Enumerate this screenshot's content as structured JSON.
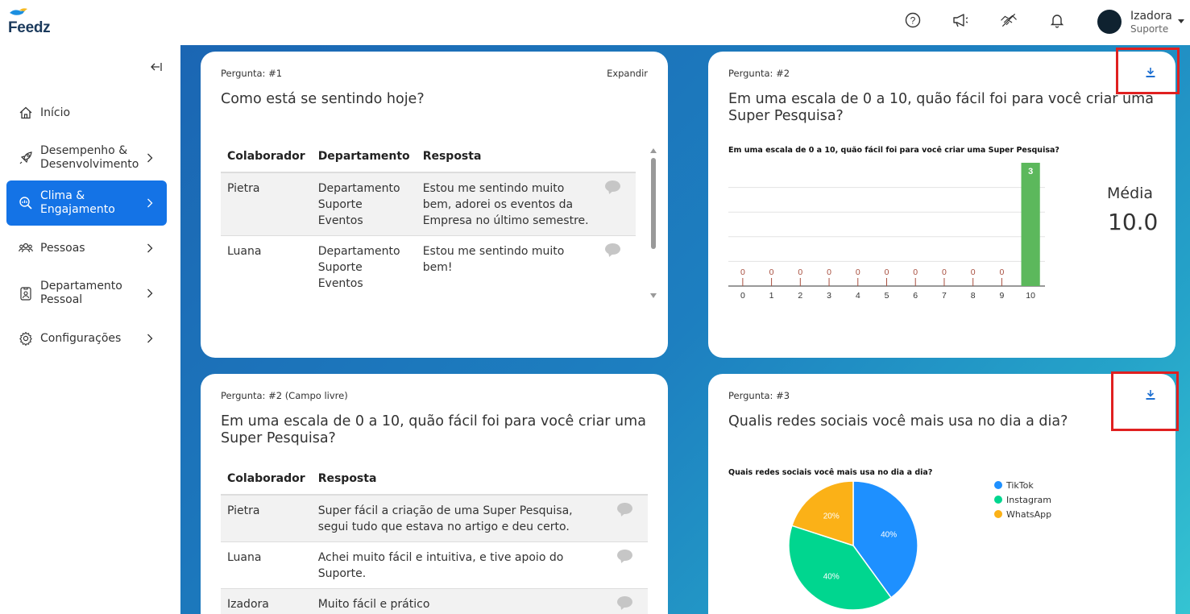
{
  "app": {
    "name": "Feedz"
  },
  "topbar": {
    "icons": [
      "help-icon",
      "megaphone-icon",
      "handshake-icon",
      "bell-icon"
    ],
    "user": {
      "name": "Izadora",
      "role": "Suporte"
    }
  },
  "sidebar": {
    "items": [
      {
        "label": "Início",
        "icon": "home-icon",
        "active": false,
        "chevron": false
      },
      {
        "label": "Desempenho &\nDesenvolvimento",
        "icon": "rocket-icon",
        "active": false,
        "chevron": true
      },
      {
        "label": "Clima &\nEngajamento",
        "icon": "magnifier-icon",
        "active": true,
        "chevron": true
      },
      {
        "label": "Pessoas",
        "icon": "people-icon",
        "active": false,
        "chevron": true
      },
      {
        "label": "Departamento\nPessoal",
        "icon": "badge-icon",
        "active": false,
        "chevron": true
      },
      {
        "label": "Configurações",
        "icon": "gear-icon",
        "active": false,
        "chevron": true
      }
    ]
  },
  "cards": {
    "q1": {
      "number": "Pergunta: #1",
      "title": "Como está se sentindo hoje?",
      "expand": "Expandir",
      "headers": [
        "Colaborador",
        "Departamento",
        "Resposta"
      ],
      "rows": [
        {
          "colaborador": "Pietra",
          "departamento": "Departamento Suporte Eventos",
          "resposta": "Estou me sentindo muito bem, adorei os eventos da Empresa no último semestre."
        },
        {
          "colaborador": "Luana",
          "departamento": "Departamento Suporte Eventos",
          "resposta": "Estou me sentindo muito bem!"
        }
      ]
    },
    "q2": {
      "number": "Pergunta: #2",
      "title": "Em uma escala de 0 a 10, quão fácil foi para você criar uma Super Pesquisa?",
      "media_label": "Média",
      "media_value": "10.0"
    },
    "q2free": {
      "number": "Pergunta: #2 (Campo livre)",
      "title": "Em uma escala de 0 a 10, quão fácil foi para você criar uma Super Pesquisa?",
      "headers": [
        "Colaborador",
        "Resposta"
      ],
      "rows": [
        {
          "colaborador": "Pietra",
          "resposta": "Super fácil a criação de uma Super Pesquisa, segui tudo que estava no artigo e deu certo."
        },
        {
          "colaborador": "Luana",
          "resposta": "Achei muito fácil e intuitiva, e tive apoio do Suporte."
        },
        {
          "colaborador": "Izadora",
          "resposta": "Muito fácil e prático"
        }
      ]
    },
    "q3": {
      "number": "Pergunta: #3",
      "title": "Qualis redes sociais você mais usa no dia a dia?"
    }
  },
  "chart_data": [
    {
      "type": "bar",
      "title": "Em uma escala de 0 a 10, quão fácil foi para você criar uma Super Pesquisa?",
      "categories": [
        "0",
        "1",
        "2",
        "3",
        "4",
        "5",
        "6",
        "7",
        "8",
        "9",
        "10"
      ],
      "values": [
        0,
        0,
        0,
        0,
        0,
        0,
        0,
        0,
        0,
        0,
        3
      ],
      "ylim": [
        0,
        3
      ],
      "colors": {
        "zero": "#a84f3f",
        "bar": "#5cb85c"
      }
    },
    {
      "type": "pie",
      "title": "Quais redes sociais você mais usa no dia a dia?",
      "labels": [
        "TikTok",
        "Instagram",
        "WhatsApp"
      ],
      "values": [
        40,
        40,
        20
      ],
      "value_labels": [
        "40%",
        "40%",
        "20%"
      ],
      "colors": [
        "#1e90ff",
        "#00d68f",
        "#fbb117"
      ],
      "legend": "right"
    }
  ]
}
